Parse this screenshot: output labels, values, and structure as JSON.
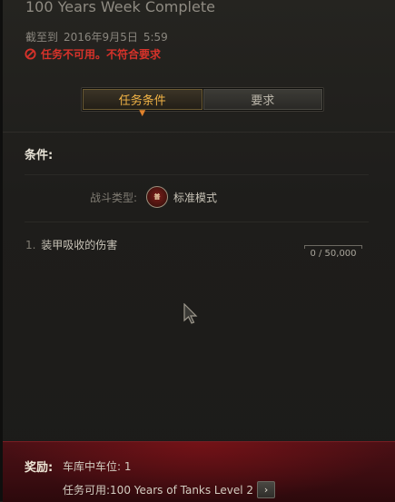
{
  "quest": {
    "title": "100 Years Week Complete",
    "deadline_label": "截至到",
    "deadline_date": "2016年9月5日",
    "deadline_time": "5:59",
    "status": "任务不可用。不符合要求"
  },
  "tabs": [
    {
      "label": "任务条件",
      "active": true
    },
    {
      "label": "要求",
      "active": false
    }
  ],
  "conditions": {
    "header": "条件:",
    "battle_type_label": "战斗类型:",
    "battle_mode_badge": "普",
    "battle_type_value": "标准模式",
    "items": [
      {
        "index": "1.",
        "text": "装甲吸收的伤害",
        "progress": "0 / 50,000"
      }
    ]
  },
  "reward": {
    "label": "奖励:",
    "line1": "车库中车位: 1",
    "line2": "任务可用:100 Years of Tanks Level 2"
  },
  "colors": {
    "accent": "#f3b446",
    "error": "#d7322a",
    "reward_bg": "#4a1015"
  }
}
